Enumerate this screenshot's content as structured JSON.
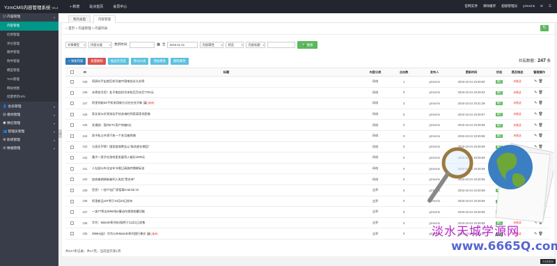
{
  "topbar": {
    "logo": "YzmCMS内容管理系统",
    "version": "V5.4",
    "nav": [
      "+ 新增",
      "站点首页",
      "会员中心"
    ],
    "right": [
      "官网支持",
      "清除缓存",
      "超级管理员",
      "yzmcms"
    ]
  },
  "sidebar": {
    "group_content": "内容管理",
    "items": [
      "内容管理",
      "栏目管理",
      "评论管理",
      "稿件管理",
      "附件管理",
      "模型管理",
      "TAG管理",
      "网站地图",
      "批量更新URL"
    ],
    "groups": [
      "会员管理",
      "模块管理",
      "微信管理",
      "管理员管理",
      "系统管理",
      "数据管理"
    ]
  },
  "tabs": [
    "我的桌面",
    "内容管理"
  ],
  "breadcrumb": "首页 > 内容管理 > 内容列表",
  "filter": {
    "model": "文章模型",
    "category": "内容分类",
    "update_label": "更新时间:",
    "date_sep": "至",
    "date_to": "2019-11-21",
    "attr": "内容属性",
    "status": "状态",
    "title_sel": "内容标题",
    "search_btn": "搜索"
  },
  "actions": [
    {
      "label": "+ 添加内容",
      "color": "#337ab7"
    },
    {
      "label": "批量删除",
      "color": "#d9534f"
    },
    {
      "label": "推送至百度",
      "color": "#5bc0de"
    },
    {
      "label": "移动分类",
      "color": "#5bc0de"
    },
    {
      "label": "增加属性",
      "color": "#5bc0de"
    },
    {
      "label": "删除属性",
      "color": "#5bc0de"
    }
  ],
  "total": {
    "label": "共有数据：",
    "count": "247",
    "unit": "条"
  },
  "table": {
    "headers": [
      "",
      "ID",
      "标题",
      "内容分类",
      "点击数",
      "发布人",
      "更新时间",
      "状态",
      "是否推送",
      "管理操作"
    ],
    "rows": [
      {
        "id": "249",
        "title": "同屏众手出差后机号被中国电信永久封停",
        "cat": "网络",
        "hits": "1",
        "user": "yzmcms",
        "time": "2019-10-24 19:29:50",
        "status": "通过",
        "push": "未推送",
        "tag": ""
      },
      {
        "id": "248",
        "title": "未将信号用！女子电信机号申机后百年后7700元",
        "cat": "网络",
        "hits": "0",
        "user": "yzmcms",
        "time": "2019-10-24 19:29:53",
        "status": "通过",
        "push": "未推送",
        "tag": ""
      },
      {
        "id": "247",
        "title": "阿里领航5G手机采用新方式在在交开新",
        "cat": "网络",
        "hits": "3",
        "user": "yzmcms",
        "time": "2019-10-24 19:31:39",
        "status": "通过",
        "push": "未推送",
        "tag": "[推荐]"
      },
      {
        "id": "246",
        "title": "家长孩11岁男孩玩手机充电时到家离家领家救",
        "cat": "网络",
        "hits": "0",
        "user": "yzmcms",
        "time": "2019-10-24 19:29:57",
        "status": "通过",
        "push": "未推送",
        "tag": ""
      },
      {
        "id": "245",
        "title": "交通部：国内ETC用户突破5亿",
        "cat": "网络",
        "hits": "0",
        "user": "yzmcms",
        "time": "2019-10-24 19:29:59",
        "status": "通过",
        "push": "未推送",
        "tag": ""
      },
      {
        "id": "244",
        "title": "男子私占共享汽车一个多月被抓捕",
        "cat": "网络",
        "hits": "0",
        "user": "yzmcms",
        "time": "2019-10-24 19:29:59",
        "status": "通过",
        "push": "未推送",
        "tag": ""
      },
      {
        "id": "243",
        "title": "与家乐不得！国家首席警告认“取消差价揭回”",
        "cat": "网络",
        "hits": "0",
        "user": "yzmcms",
        "time": "2019-10-24 19:29:59",
        "status": "通过",
        "push": "未推送",
        "tag": ""
      },
      {
        "id": "242",
        "title": "重大一男子在游戏里发展驾入被历1000元",
        "cat": "网络",
        "hits": "0",
        "user": "yzmcms",
        "time": "2019-10-24 19:29:59",
        "status": "通过",
        "push": "未推送",
        "tag": ""
      },
      {
        "id": "241",
        "title": "人社部公布法宝年节假日高施并拥联标准",
        "cat": "网络",
        "hits": "0",
        "user": "yzmcms",
        "time": "2019-10-24 19:29:59",
        "status": "通过",
        "push": "未推送",
        "tag": ""
      },
      {
        "id": "240",
        "title": "加农森柄柄新被利人失信“黑名单”",
        "cat": "网络",
        "hits": "0",
        "user": "yzmcms",
        "time": "2019-10-24 19:29:59",
        "status": "通过",
        "push": "未推送",
        "tag": ""
      },
      {
        "id": "239",
        "title": "官宣！一加7T出厂即搭载Android 10",
        "cat": "业界",
        "hits": "0",
        "user": "yzmcms",
        "time": "2019-10-24 19:29:59",
        "status": "通过",
        "push": "未推送",
        "tag": ""
      },
      {
        "id": "238",
        "title": "阿里新品16T将于10月23日发布",
        "cat": "业界",
        "hits": "0",
        "user": "yzmcms",
        "time": "2019-10-24 19:29:59",
        "status": "通过",
        "push": "未推送",
        "tag": ""
      },
      {
        "id": "237",
        "title": "一加7T将支持960fps慢动作视频拍摄功能",
        "cat": "业界",
        "hits": "0",
        "user": "yzmcms",
        "time": "2019-10-24 19:29:59",
        "status": "通过",
        "push": "未推送",
        "tag": ""
      },
      {
        "id": "236",
        "title": "华为：Mate30系列5G版将于11月1日发售",
        "cat": "业界",
        "hits": "0",
        "user": "yzmcms",
        "time": "2019-10-24 19:29:59",
        "status": "通过",
        "push": "未推送",
        "tag": ""
      },
      {
        "id": "235",
        "title": "3999元起！华为公布Mate30系列国行售价",
        "cat": "业界",
        "hits": "0",
        "user": "yzmcms",
        "time": "2019-10-24 19:29:59",
        "status": "通过",
        "push": "未推送",
        "tag": "[推荐]"
      }
    ]
  },
  "footer": "共247条记录，共17页，当前显示第1页",
  "timer": "0.0182s",
  "watermark": {
    "text": "淡水天城学源网",
    "url": "www.6665Q.com"
  }
}
